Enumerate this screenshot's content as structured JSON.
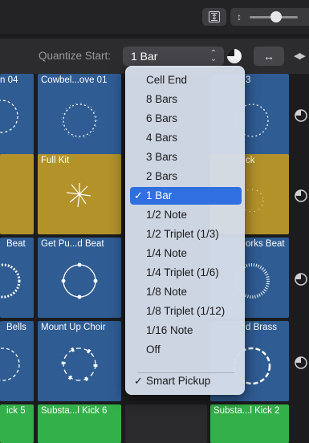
{
  "toolbar": {
    "fit_icon": "fit-vertical-icon",
    "zoom_icon": "vertical-zoom-icon",
    "zoom_level": 0.55
  },
  "quantize": {
    "label": "Quantize Start:",
    "value": "1 Bar",
    "pie_icon": "pie-clock-icon",
    "expand_icon": "expand-horizontal-icon",
    "nav_icon": "play-arrows-icon"
  },
  "cells": {
    "r1c1": "n 04",
    "r1c2": "Cowbel...ove 01",
    "r1c4": "3",
    "r2c2": "Full Kit",
    "r2c4": "ck",
    "r3c1": "Beat",
    "r3c2": "Get Pu...d Beat",
    "r3c4": "orks Beat",
    "r4c1": "Bells",
    "r4c2": "Mount Up Choir",
    "r4c4": "d Brass",
    "r5c1": "ick 5",
    "r5c2": "Substa...l Kick 6",
    "r5c4": "Substa...l Kick 2"
  },
  "menu": {
    "items": [
      {
        "label": "Cell End",
        "selected": false
      },
      {
        "label": "8 Bars",
        "selected": false
      },
      {
        "label": "6 Bars",
        "selected": false
      },
      {
        "label": "4 Bars",
        "selected": false
      },
      {
        "label": "3 Bars",
        "selected": false
      },
      {
        "label": "2 Bars",
        "selected": false
      },
      {
        "label": "1 Bar",
        "selected": true
      },
      {
        "label": "1/2 Note",
        "selected": false
      },
      {
        "label": "1/2 Triplet (1/3)",
        "selected": false
      },
      {
        "label": "1/4 Note",
        "selected": false
      },
      {
        "label": "1/4 Triplet (1/6)",
        "selected": false
      },
      {
        "label": "1/8 Note",
        "selected": false
      },
      {
        "label": "1/8 Triplet (1/12)",
        "selected": false
      },
      {
        "label": "1/16 Note",
        "selected": false
      },
      {
        "label": "Off",
        "selected": false
      }
    ],
    "smart_pickup": {
      "label": "Smart Pickup",
      "checked": true
    },
    "check_glyph": "✓"
  },
  "colors": {
    "blue": "#2f5c93",
    "gold": "#b3922a",
    "green": "#33b049",
    "menu_highlight": "#2f6fe0"
  }
}
